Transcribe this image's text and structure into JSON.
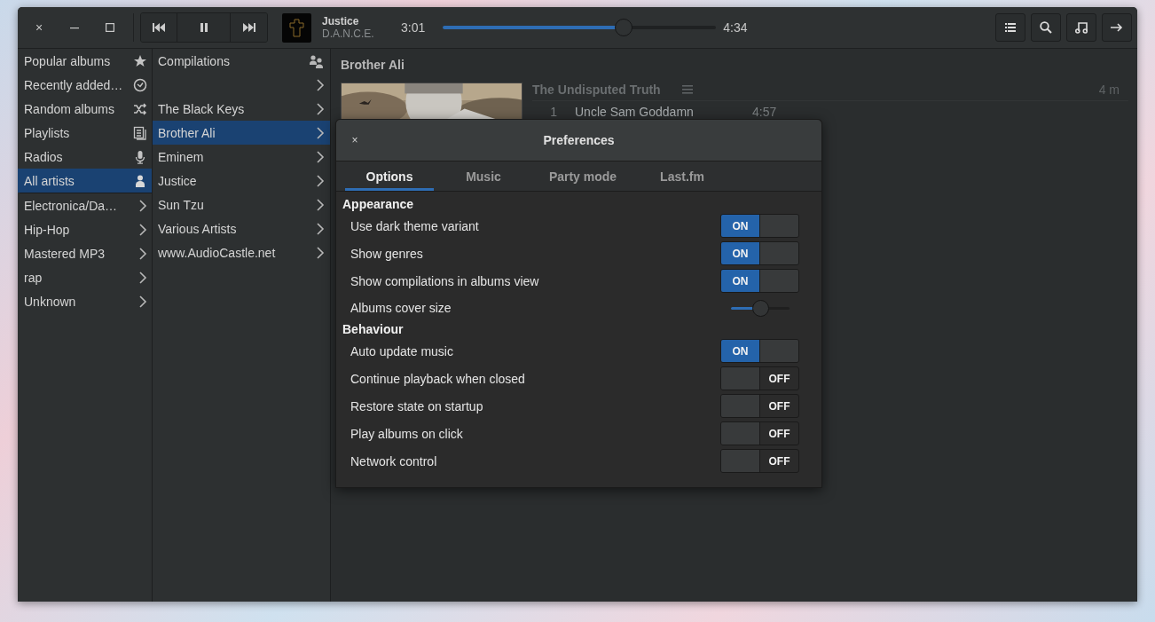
{
  "window": {
    "close": "×"
  },
  "player": {
    "now_playing": {
      "title": "Justice",
      "artist": "D.A.N.C.E."
    },
    "elapsed": "3:01",
    "total": "4:34",
    "progress": {
      "level": 0.66
    }
  },
  "sidebar": {
    "views": [
      {
        "label": "Popular albums",
        "selected": false
      },
      {
        "label": "Recently added…",
        "selected": false
      },
      {
        "label": "Random albums",
        "selected": false
      },
      {
        "label": "Playlists",
        "selected": false
      },
      {
        "label": "Radios",
        "selected": false
      },
      {
        "label": "All artists",
        "selected": true
      }
    ],
    "genres": [
      {
        "label": "Electronica/Da…",
        "selected": false
      },
      {
        "label": "Hip-Hop",
        "selected": false
      },
      {
        "label": "Mastered MP3",
        "selected": false
      },
      {
        "label": "rap",
        "selected": false
      },
      {
        "label": "Unknown",
        "selected": false
      }
    ]
  },
  "artists": [
    {
      "label": "Compilations",
      "kind": "compilations",
      "selected": false
    },
    {
      "kind": "artist",
      "selected": false
    },
    {
      "label": "The Black Keys",
      "kind": "artist",
      "selected": false
    },
    {
      "label": "Brother Ali",
      "kind": "artist",
      "selected": true
    },
    {
      "label": "Eminem",
      "kind": "artist",
      "selected": false
    },
    {
      "label": "Justice",
      "kind": "artist",
      "selected": false
    },
    {
      "label": "Sun Tzu",
      "kind": "artist",
      "selected": false
    },
    {
      "label": "Various Artists",
      "kind": "artist",
      "selected": false
    },
    {
      "label": "www.AudioCastle.net",
      "kind": "artist",
      "selected": false
    }
  ],
  "content": {
    "artist": "Brother Ali",
    "album": {
      "title": "The Undisputed Truth",
      "duration": "4 m",
      "tracks": [
        {
          "number": "1",
          "title": "Uncle Sam Goddamn",
          "duration": "4:57"
        }
      ]
    }
  },
  "dialog": {
    "title": "Preferences",
    "close": "×",
    "tabs": [
      {
        "label": "Options",
        "selected": true
      },
      {
        "label": "Music",
        "selected": false
      },
      {
        "label": "Party mode",
        "selected": false
      },
      {
        "label": "Last.fm",
        "selected": false
      }
    ],
    "sections": [
      {
        "heading": "Appearance",
        "rows": [
          {
            "label": "Use dark theme variant",
            "kind": "switch",
            "on": true,
            "state_text": "ON"
          },
          {
            "label": "Show genres",
            "kind": "switch",
            "on": true,
            "state_text": "ON"
          },
          {
            "label": "Show compilations in albums view",
            "kind": "switch",
            "on": true,
            "state_text": "ON"
          },
          {
            "label": "Albums cover size",
            "kind": "slider",
            "level": 0.5
          }
        ]
      },
      {
        "heading": "Behaviour",
        "rows": [
          {
            "label": "Auto update music",
            "kind": "switch",
            "on": true,
            "state_text": "ON"
          },
          {
            "label": "Continue playback when closed",
            "kind": "switch",
            "on": false,
            "state_text": "OFF"
          },
          {
            "label": "Restore state on startup",
            "kind": "switch",
            "on": false,
            "state_text": "OFF"
          },
          {
            "label": "Play albums on click",
            "kind": "switch",
            "on": false,
            "state_text": "OFF"
          },
          {
            "label": "Network control",
            "kind": "switch",
            "on": false,
            "state_text": "OFF"
          }
        ]
      }
    ]
  }
}
